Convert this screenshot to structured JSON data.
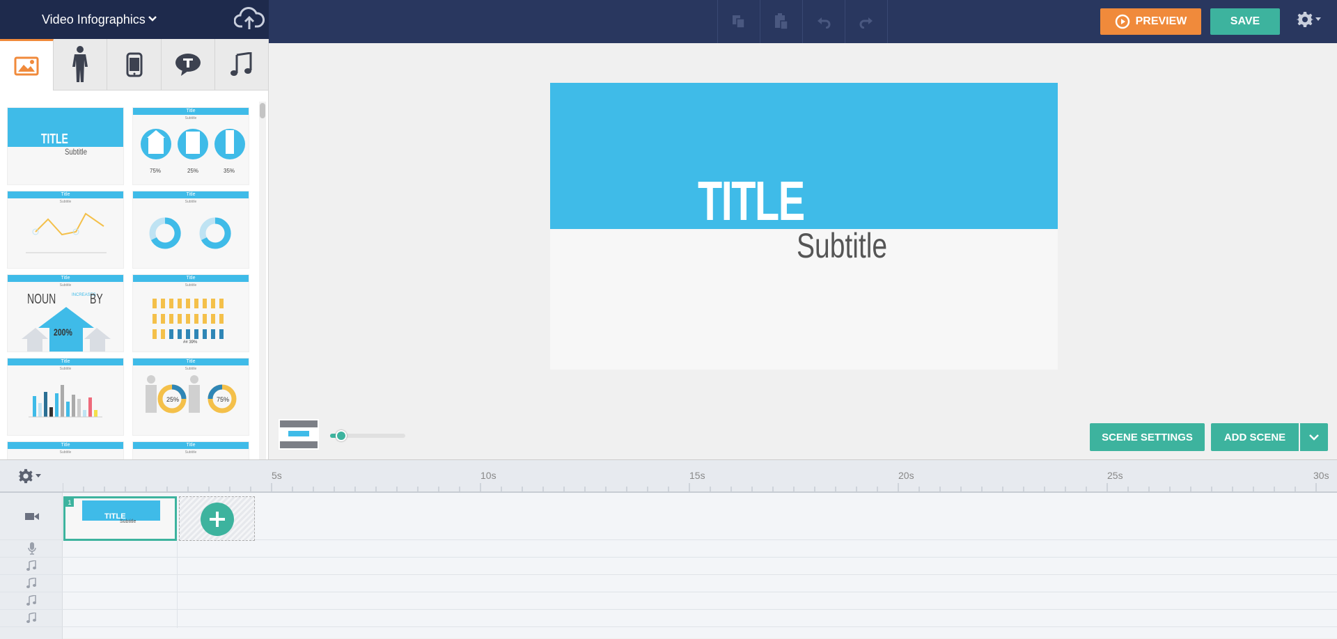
{
  "header": {
    "project_title": "Video Infographics",
    "preview_label": "PREVIEW",
    "save_label": "SAVE"
  },
  "library": {
    "tabs": [
      "images",
      "characters",
      "devices",
      "text",
      "music"
    ],
    "active_tab": "images",
    "templates": [
      {
        "title": "TITLE",
        "subtitle": "Subtitle"
      },
      {
        "title": "Title",
        "subtitle": "Subtitle",
        "values": [
          "75%",
          "25%",
          "35%"
        ]
      },
      {
        "title": "Title",
        "subtitle": "Subtitle"
      },
      {
        "title": "Title",
        "subtitle": "Subtitle"
      },
      {
        "title": "Title",
        "subtitle": "Subtitle",
        "text": [
          "NOUN",
          "INCREASES",
          "BY",
          "200%"
        ]
      },
      {
        "title": "Title",
        "subtitle": "Subtitle",
        "caption": "## 39%"
      },
      {
        "title": "Title",
        "subtitle": "Subtitle"
      },
      {
        "title": "Title",
        "subtitle": "Subtitle",
        "values": [
          "25%",
          "75%"
        ]
      },
      {
        "title": "Title",
        "subtitle": "Subtitle"
      },
      {
        "title": "Title",
        "subtitle": "Subtitle"
      }
    ]
  },
  "canvas": {
    "title": "TITLE",
    "subtitle": "Subtitle",
    "colors": {
      "top": "#3fbbe8",
      "bottom": "#f7f7f7"
    }
  },
  "zoom": {
    "level": 0.15
  },
  "buttons": {
    "scene_settings": "SCENE SETTINGS",
    "add_scene": "ADD SCENE"
  },
  "timeline": {
    "ticks": [
      "5s",
      "10s",
      "15s",
      "20s",
      "25s",
      "30s"
    ],
    "scene": {
      "number": "1",
      "title": "TITLE",
      "subtitle": "Subtitle"
    },
    "tracks": [
      "video",
      "voice",
      "music",
      "music",
      "music",
      "music"
    ]
  },
  "colors": {
    "accent_green": "#3db39e",
    "accent_orange": "#f08a3b",
    "nav": "#29375f"
  }
}
